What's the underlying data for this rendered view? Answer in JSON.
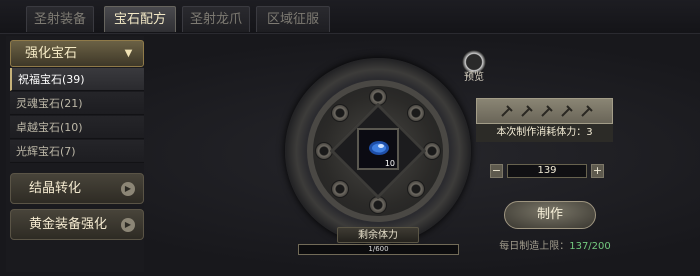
{
  "tabs": [
    {
      "label": "圣射装备",
      "active": false
    },
    {
      "label": "宝石配方",
      "active": true
    },
    {
      "label": "圣射龙爪",
      "active": false
    },
    {
      "label": "区域征服",
      "active": false
    }
  ],
  "sidebar": {
    "category_label": "强化宝石",
    "category_icon": "chevron-down-icon",
    "items": [
      {
        "label": "祝福宝石(39)",
        "selected": true
      },
      {
        "label": "灵魂宝石(21)",
        "selected": false
      },
      {
        "label": "卓越宝石(10)",
        "selected": false
      },
      {
        "label": "光辉宝石(7)",
        "selected": false
      }
    ],
    "crystal_label": "结晶转化",
    "gold_label": "黄金装备强化"
  },
  "center": {
    "preview_label": "预览",
    "preview_icon": "magnifier-icon",
    "slot_count": "10",
    "gem_icon": "blessing-jewel-icon",
    "stamina_label": "剩余体力",
    "stamina_text": "1/600",
    "stamina_value": 1,
    "stamina_max": 600
  },
  "right": {
    "material_icon": "hammer-icon",
    "cost_text": "本次制作消耗体力：3",
    "qty_minus": "−",
    "qty_value": "139",
    "qty_plus": "+",
    "make_label": "制作",
    "daily_label": "每日制造上限：",
    "daily_value": "137/200"
  },
  "colors": {
    "accent_gold": "#c6b27a",
    "daily_green": "#73c97f",
    "gem_blue": "#3f7fe0"
  }
}
